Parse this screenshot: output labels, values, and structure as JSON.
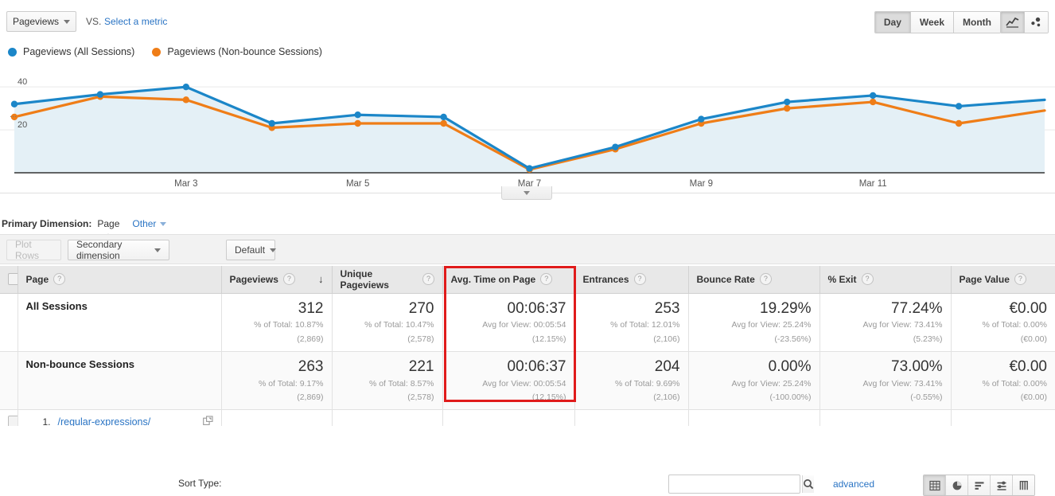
{
  "metric_bar": {
    "primary_metric": "Pageviews",
    "vs_label": "VS.",
    "select_metric_link": "Select a metric",
    "granularity": [
      "Day",
      "Week",
      "Month"
    ],
    "granularity_selected": "Day",
    "chart_types": [
      "line-chart-icon",
      "motion-chart-icon"
    ],
    "chart_type_selected": "line-chart-icon"
  },
  "legend": [
    {
      "label": "Pageviews (All Sessions)",
      "color": "#1b86c8"
    },
    {
      "label": "Pageviews (Non-bounce Sessions)",
      "color": "#ef7d17"
    }
  ],
  "chart_data": {
    "type": "line",
    "title": "",
    "xlabel": "",
    "ylabel": "Pageviews",
    "ylim": [
      0,
      46
    ],
    "yticks": [
      20,
      40
    ],
    "grid": true,
    "legend_position": "top-left",
    "truncation_marker": "...",
    "x": [
      "Mar 1",
      "Mar 2",
      "Mar 3",
      "Mar 4",
      "Mar 5",
      "Mar 6",
      "Mar 7",
      "Mar 8",
      "Mar 9",
      "Mar 10",
      "Mar 11",
      "Mar 12",
      "Mar 13"
    ],
    "xtick_labels": [
      "Mar 3",
      "Mar 5",
      "Mar 7",
      "Mar 9",
      "Mar 11"
    ],
    "series": [
      {
        "name": "Pageviews (All Sessions)",
        "color": "#1b86c8",
        "values": [
          32,
          36.5,
          40,
          23,
          27,
          26,
          2,
          12,
          25,
          33,
          36,
          31,
          34
        ]
      },
      {
        "name": "Pageviews (Non-bounce Sessions)",
        "color": "#ef7d17",
        "values": [
          26,
          35.5,
          34,
          21,
          23,
          23,
          1.5,
          11,
          23,
          30,
          33,
          23,
          29
        ]
      }
    ]
  },
  "primary_dimension": {
    "label": "Primary Dimension:",
    "value": "Page",
    "other": "Other"
  },
  "toolbar": {
    "plot_rows": "Plot Rows",
    "secondary_dimension": "Secondary dimension",
    "sort_type_label": "Sort Type:",
    "sort_type_value": "Default",
    "search_value": "",
    "search_placeholder": "",
    "advanced": "advanced",
    "view_icons": [
      "table-view-icon",
      "pie-view-icon",
      "bar-view-icon",
      "comparison-view-icon",
      "pivot-view-icon"
    ],
    "view_selected": "table-view-icon"
  },
  "table": {
    "columns": [
      {
        "label": "Page",
        "align": "left",
        "sorted": false
      },
      {
        "label": "Pageviews",
        "align": "right",
        "sorted": true,
        "sort_direction": "desc"
      },
      {
        "label": "Unique Pageviews",
        "align": "right",
        "sorted": false
      },
      {
        "label": "Avg. Time on Page",
        "align": "right",
        "sorted": false,
        "highlighted": true
      },
      {
        "label": "Entrances",
        "align": "right",
        "sorted": false
      },
      {
        "label": "Bounce Rate",
        "align": "right",
        "sorted": false
      },
      {
        "label": "% Exit",
        "align": "right",
        "sorted": false
      },
      {
        "label": "Page Value",
        "align": "right",
        "sorted": false
      }
    ],
    "summary_rows": [
      {
        "segment": "All Sessions",
        "cells": [
          {
            "value": "312",
            "sub1": "% of Total: 10.87%",
            "sub2": "(2,869)"
          },
          {
            "value": "270",
            "sub1": "% of Total: 10.47%",
            "sub2": "(2,578)"
          },
          {
            "value": "00:06:37",
            "sub1": "Avg for View: 00:05:54",
            "sub2": "(12.15%)"
          },
          {
            "value": "253",
            "sub1": "% of Total: 12.01%",
            "sub2": "(2,106)"
          },
          {
            "value": "19.29%",
            "sub1": "Avg for View: 25.24%",
            "sub2": "(-23.56%)"
          },
          {
            "value": "77.24%",
            "sub1": "Avg for View: 73.41%",
            "sub2": "(5.23%)"
          },
          {
            "value": "€0.00",
            "sub1": "% of Total: 0.00%",
            "sub2": "(€0.00)"
          }
        ]
      },
      {
        "segment": "Non-bounce Sessions",
        "cells": [
          {
            "value": "263",
            "sub1": "% of Total: 9.17%",
            "sub2": "(2,869)"
          },
          {
            "value": "221",
            "sub1": "% of Total: 8.57%",
            "sub2": "(2,578)"
          },
          {
            "value": "00:06:37",
            "sub1": "Avg for View: 00:05:54",
            "sub2": "(12.15%)"
          },
          {
            "value": "204",
            "sub1": "% of Total: 9.69%",
            "sub2": "(2,106)"
          },
          {
            "value": "0.00%",
            "sub1": "Avg for View: 25.24%",
            "sub2": "(-100.00%)"
          },
          {
            "value": "73.00%",
            "sub1": "Avg for View: 73.41%",
            "sub2": "(-0.55%)"
          },
          {
            "value": "€0.00",
            "sub1": "% of Total: 0.00%",
            "sub2": "(€0.00)"
          }
        ]
      }
    ],
    "page_rows": [
      {
        "index": "1.",
        "url": "/regular-expressions/"
      }
    ]
  },
  "annotation": {
    "highlight_color": "#e01b1b",
    "highlighted_column": "Avg. Time on Page"
  }
}
